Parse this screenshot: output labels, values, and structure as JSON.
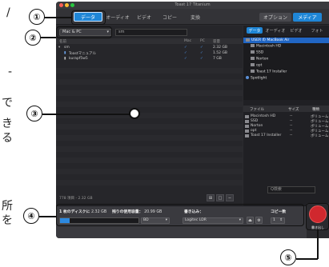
{
  "window": {
    "title": "Toast 17 Titanium"
  },
  "toolbar": {
    "tabs": [
      "データ",
      "オーディオ",
      "ビデオ",
      "コピー",
      "変換"
    ],
    "right_tabs": [
      "オプション",
      "メディア"
    ]
  },
  "browser": {
    "source": "Mac & PC",
    "path": "sm",
    "columns": [
      "名前",
      "Mac",
      "PC",
      "容量"
    ],
    "rows": [
      {
        "name": "sm",
        "mac": "✓",
        "pc": "✓",
        "size": "2.32 GB"
      },
      {
        "name": "Toastマニュアル",
        "mac": "✓",
        "pc": "✓",
        "size": "1.52 GB"
      },
      {
        "name": "kurapf5w5",
        "mac": "✓",
        "pc": "✓",
        "size": "7 GB"
      }
    ],
    "status": "778 項目 - 2.32 GB"
  },
  "media": {
    "tabs": [
      "データ",
      "オーディオ",
      "ビデオ",
      "フォト"
    ],
    "tree": [
      {
        "label": "USER の MacBook Air",
        "selected": true
      },
      {
        "label": "Macintosh HD",
        "selected": false
      },
      {
        "label": "SSD",
        "selected": false
      },
      {
        "label": "Norton",
        "selected": false
      },
      {
        "label": "opt",
        "selected": false
      },
      {
        "label": "Toast 17 Installer",
        "selected": false
      },
      {
        "label": "Spotlight",
        "selected": false
      }
    ],
    "list_columns": [
      "ファイル",
      "サイズ",
      "種類"
    ],
    "list_rows": [
      {
        "name": "Macintosh HD",
        "size": "--",
        "kind": "ボリューム"
      },
      {
        "name": "SSD",
        "size": "--",
        "kind": "ボリューム"
      },
      {
        "name": "Norton",
        "size": "--",
        "kind": "ボリューム"
      },
      {
        "name": "opt",
        "size": "--",
        "kind": "ボリューム"
      },
      {
        "name": "Toast 17 Installer",
        "size": "--",
        "kind": "ボリューム"
      }
    ],
    "search_placeholder": "Q検索"
  },
  "bottom": {
    "disc_label": "1 枚のディスクに",
    "disc_value": "2.32 GB",
    "remaining_label": "残りの使用容量：",
    "remaining_value": "20.99 GB",
    "device_label": "書き込み：",
    "copies_label": "コピー数",
    "disc_type": "BD",
    "device": "Logitec LDR",
    "copies": "1",
    "progress": 0.12
  },
  "copy_button": {
    "label": "書き出し"
  },
  "callouts": [
    "①",
    "②",
    "③",
    "④",
    "⑤"
  ],
  "doc_text": [
    "/",
    "-",
    "で",
    "き",
    "る",
    "所",
    "を"
  ]
}
